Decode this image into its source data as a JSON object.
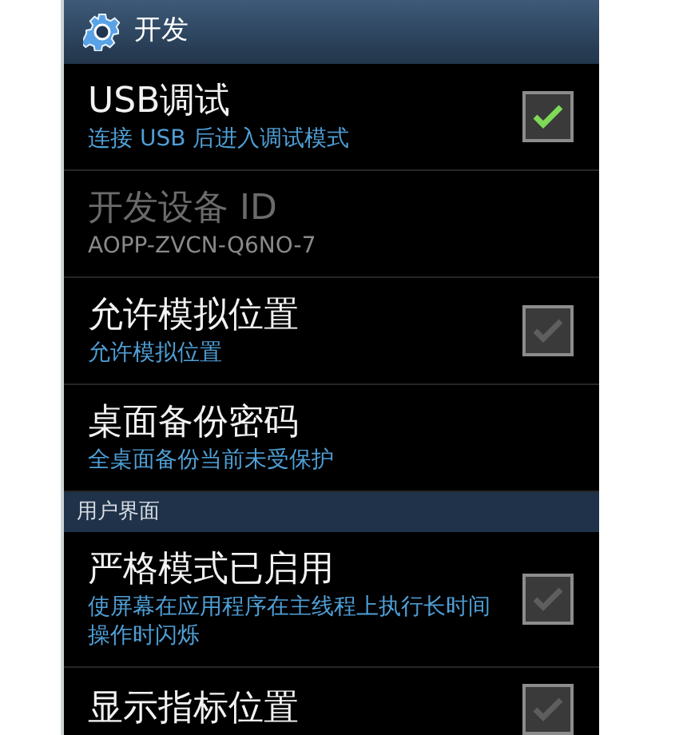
{
  "header": {
    "title": "开发"
  },
  "sections": [
    {
      "items": [
        {
          "kind": "checkbox",
          "title": "USB调试",
          "summary": "连接 USB 后进入调试模式",
          "checked": true,
          "disabled": false
        },
        {
          "kind": "text",
          "title": "开发设备 ID",
          "summary": "AOPP-ZVCN-Q6NO-7",
          "disabled": true
        },
        {
          "kind": "checkbox",
          "title": "允许模拟位置",
          "summary": "允许模拟位置",
          "checked": false,
          "disabled": false
        },
        {
          "kind": "text",
          "title": "桌面备份密码",
          "summary": "全桌面备份当前未受保护",
          "disabled": false
        }
      ]
    },
    {
      "title": "用户界面",
      "items": [
        {
          "kind": "checkbox",
          "title": "严格模式已启用",
          "summary": "使屏幕在应用程序在主线程上执行长时间操作时闪烁",
          "checked": false,
          "disabled": false
        },
        {
          "kind": "checkbox",
          "title": "显示指标位置",
          "checked": false,
          "disabled": false
        }
      ]
    }
  ]
}
